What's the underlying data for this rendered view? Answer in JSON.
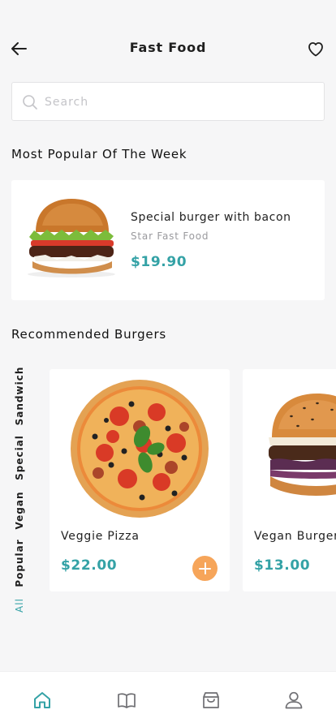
{
  "header": {
    "title": "Fast Food",
    "back_icon": "arrow-left-icon",
    "favorite_icon": "heart-icon"
  },
  "search": {
    "placeholder": "Search",
    "value": "",
    "icon": "search-icon"
  },
  "popular": {
    "section_title": "Most Popular Of The Week",
    "item": {
      "name": "Special burger with bacon",
      "shop": "Star Fast Food",
      "price": "$19.90"
    }
  },
  "recommended": {
    "section_title": "Recommended Burgers",
    "categories": [
      {
        "label": "Sandwich",
        "active": false
      },
      {
        "label": "Special",
        "active": false
      },
      {
        "label": "Vegan",
        "active": false
      },
      {
        "label": "Popular",
        "active": false
      },
      {
        "label": "All",
        "active": true
      }
    ],
    "products": [
      {
        "name": "Veggie Pizza",
        "price": "$22.00"
      },
      {
        "name": "Vegan Burger",
        "price": "$13.00"
      }
    ]
  },
  "bottom_nav": {
    "items": [
      {
        "icon": "home-icon",
        "active": true
      },
      {
        "icon": "book-icon",
        "active": false
      },
      {
        "icon": "shopping-bag-icon",
        "active": false
      },
      {
        "icon": "user-icon",
        "active": false
      }
    ]
  },
  "colors": {
    "accent": "#34a2a6",
    "add_button": "#f6a55a",
    "background": "#f6f6f7",
    "card": "#ffffff"
  }
}
